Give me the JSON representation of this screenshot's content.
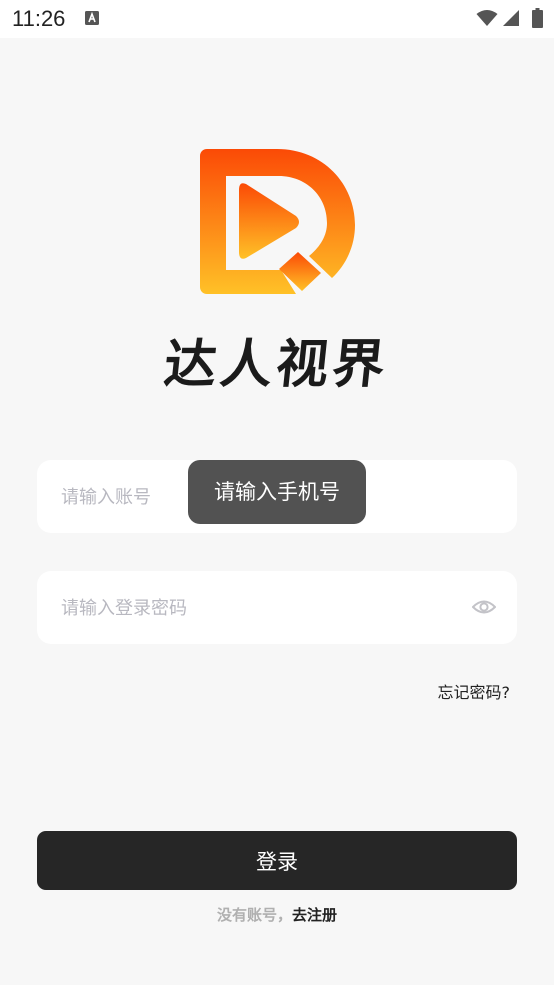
{
  "status_bar": {
    "time": "11:26",
    "icons": [
      "a-notification-icon",
      "wifi-icon",
      "signal-icon",
      "battery-icon"
    ]
  },
  "app": {
    "brand_name": "达人视界",
    "logo_icon": "play-d-logo",
    "colors": {
      "logo_top": "#fb4a06",
      "logo_bottom": "#ffc127",
      "button": "#262626"
    }
  },
  "form": {
    "account_placeholder": "请输入账号",
    "password_placeholder": "请输入登录密码",
    "password_toggle_icon": "eye-icon",
    "forgot_label": "忘记密码?",
    "login_label": "登录"
  },
  "toast": {
    "message": "请输入手机号"
  },
  "register": {
    "prompt": "没有账号，",
    "link_label": "去注册"
  }
}
